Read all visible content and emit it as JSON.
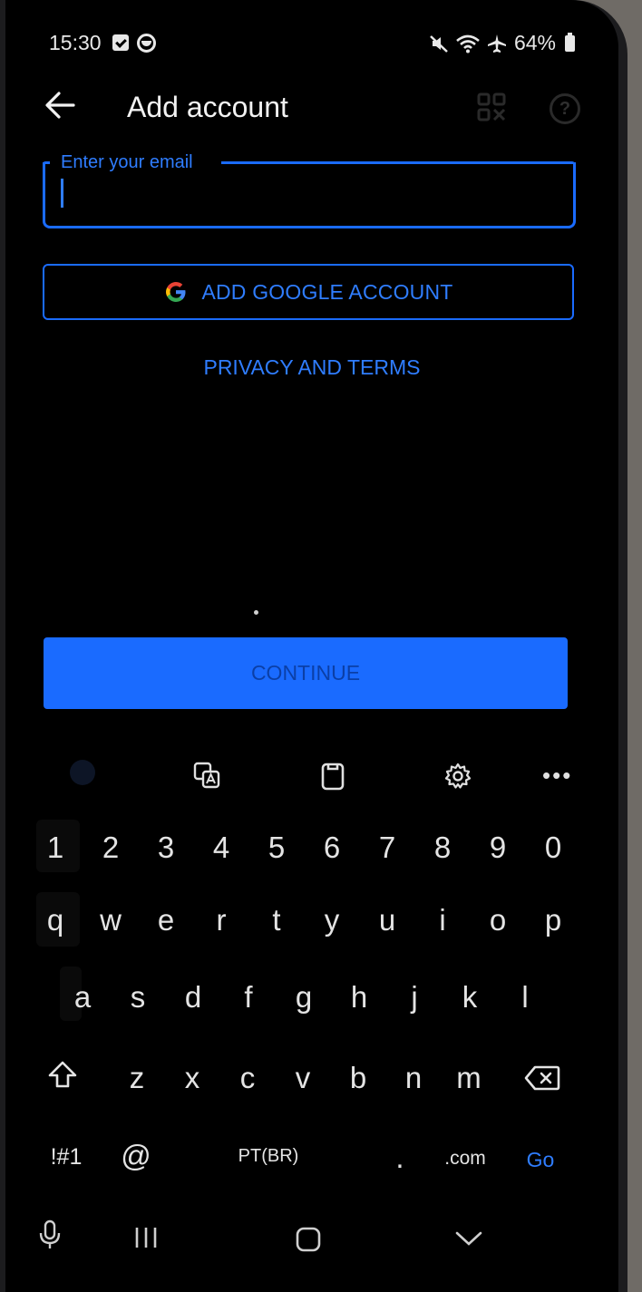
{
  "status_bar": {
    "time": "15:30",
    "battery": "64%"
  },
  "app_bar": {
    "title": "Add account"
  },
  "email": {
    "label": "Enter your email",
    "value": "",
    "placeholder": ""
  },
  "google_button": {
    "label": "ADD GOOGLE ACCOUNT"
  },
  "privacy_link": {
    "label": "PRIVACY AND TERMS"
  },
  "continue_button": {
    "label": "CONTINUE"
  },
  "keyboard": {
    "numbers": [
      "1",
      "2",
      "3",
      "4",
      "5",
      "6",
      "7",
      "8",
      "9",
      "0"
    ],
    "row1": [
      "q",
      "w",
      "e",
      "r",
      "t",
      "y",
      "u",
      "i",
      "o",
      "p"
    ],
    "row2": [
      "a",
      "s",
      "d",
      "f",
      "g",
      "h",
      "j",
      "k",
      "l"
    ],
    "row3": [
      "z",
      "x",
      "c",
      "v",
      "b",
      "n",
      "m"
    ],
    "symbols_key": "!#1",
    "at_key": "@",
    "space_key": "PT(BR)",
    "period_key": ".",
    "com_key": ".com",
    "go_key": "Go"
  },
  "colors": {
    "accent": "#1a6bff",
    "background": "#000000",
    "key_text": "#e4e4e4"
  }
}
